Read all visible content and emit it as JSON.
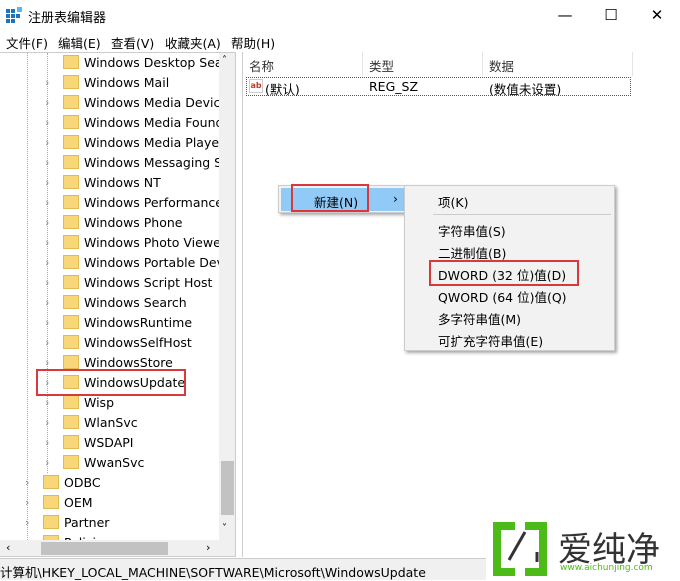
{
  "window": {
    "title": "注册表编辑器",
    "minimize": "—",
    "maximize": "☐",
    "close": "✕"
  },
  "menus": [
    "文件(F)",
    "编辑(E)",
    "查看(V)",
    "收藏夹(A)",
    "帮助(H)"
  ],
  "tree": {
    "children": [
      "Windows Desktop Sear",
      "Windows Mail",
      "Windows Media Device",
      "Windows Media Founda",
      "Windows Media Player",
      "Windows Messaging Su",
      "Windows NT",
      "Windows Performance T",
      "Windows Phone",
      "Windows Photo Viewer",
      "Windows Portable Devic",
      "Windows Script Host",
      "Windows Search",
      "WindowsRuntime",
      "WindowsSelfHost",
      "WindowsStore",
      "WindowsUpdate",
      "Wisp",
      "WlanSvc",
      "WSDAPI",
      "WwanSvc"
    ],
    "siblings": [
      "ODBC",
      "OEM",
      "Partner",
      "Polici"
    ],
    "selected": "WindowsUpdate"
  },
  "list": {
    "columns": [
      "名称",
      "类型",
      "数据"
    ],
    "rows": [
      {
        "name": "(默认)",
        "type": "REG_SZ",
        "data": "(数值未设置)"
      }
    ]
  },
  "context_menu": {
    "new": "新建(N)",
    "arrow": "›"
  },
  "submenu": {
    "items": [
      "项(K)",
      "字符串值(S)",
      "二进制值(B)",
      "DWORD (32 位)值(D)",
      "QWORD (64 位)值(Q)",
      "多字符串值(M)",
      "可扩充字符串值(E)"
    ],
    "highlighted": "DWORD (32 位)值(D)"
  },
  "statusbar": {
    "path": "计算机\\HKEY_LOCAL_MACHINE\\SOFTWARE\\Microsoft\\WindowsUpdate"
  },
  "watermark": {
    "brand": "爱纯净",
    "url": "www.aichunjing.com"
  },
  "colors": {
    "highlight": "#91c9f7",
    "redbox": "#d9393c",
    "folder": "#f8d77a",
    "watermark": "#4cbb17"
  }
}
